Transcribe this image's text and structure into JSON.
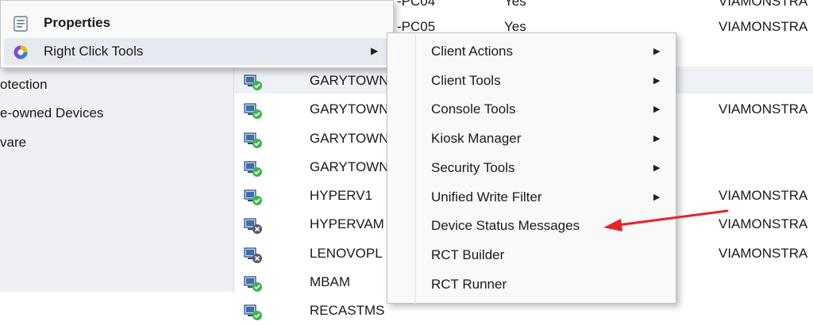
{
  "nav": {
    "items": [
      {
        "label": "otection"
      },
      {
        "label": "e-owned Devices"
      },
      {
        "label": "vare"
      }
    ]
  },
  "devices": {
    "top_rows": [
      {
        "name": "-PC04",
        "client": "Yes",
        "domain": "VIAMONSTRA"
      },
      {
        "name": "-PC05",
        "client": "Yes",
        "domain": "VIAMONSTRA"
      }
    ],
    "rows": [
      {
        "name": "GARYTOWN",
        "status": "ok",
        "domain": ""
      },
      {
        "name": "GARYTOWN",
        "status": "ok",
        "domain": "VIAMONSTRA"
      },
      {
        "name": "GARYTOWN",
        "status": "ok",
        "domain": ""
      },
      {
        "name": "GARYTOWN",
        "status": "ok",
        "domain": ""
      },
      {
        "name": "HYPERV1",
        "status": "ok",
        "domain": "VIAMONSTRA"
      },
      {
        "name": "HYPERVAM",
        "status": "error",
        "domain": "VIAMONSTRA"
      },
      {
        "name": "LENOVOPL",
        "status": "error",
        "domain": "VIAMONSTRA"
      },
      {
        "name": "MBAM",
        "status": "ok",
        "domain": ""
      },
      {
        "name": "RECASTMS",
        "status": "ok",
        "domain": ""
      }
    ]
  },
  "context_menu": {
    "items": [
      {
        "label": "Properties",
        "icon": "properties-icon",
        "bold": true
      },
      {
        "label": "Right Click Tools",
        "icon": "right-click-tools-icon",
        "submenu": true
      }
    ]
  },
  "submenu": {
    "items": [
      {
        "label": "Client Actions",
        "submenu": true
      },
      {
        "label": "Client Tools",
        "submenu": true
      },
      {
        "label": "Console Tools",
        "submenu": true
      },
      {
        "label": "Kiosk Manager",
        "submenu": true
      },
      {
        "label": "Security Tools",
        "submenu": true
      },
      {
        "label": "Unified Write Filter",
        "submenu": true
      },
      {
        "label": "Device Status Messages",
        "submenu": false
      },
      {
        "label": "RCT Builder",
        "submenu": false
      },
      {
        "label": "RCT Runner",
        "submenu": false
      }
    ]
  },
  "annotation": {
    "type": "arrow",
    "color": "#e8212a"
  },
  "colors": {
    "ok": "#3fb54a",
    "error": "#555a66",
    "arrow": "#e8212a"
  }
}
